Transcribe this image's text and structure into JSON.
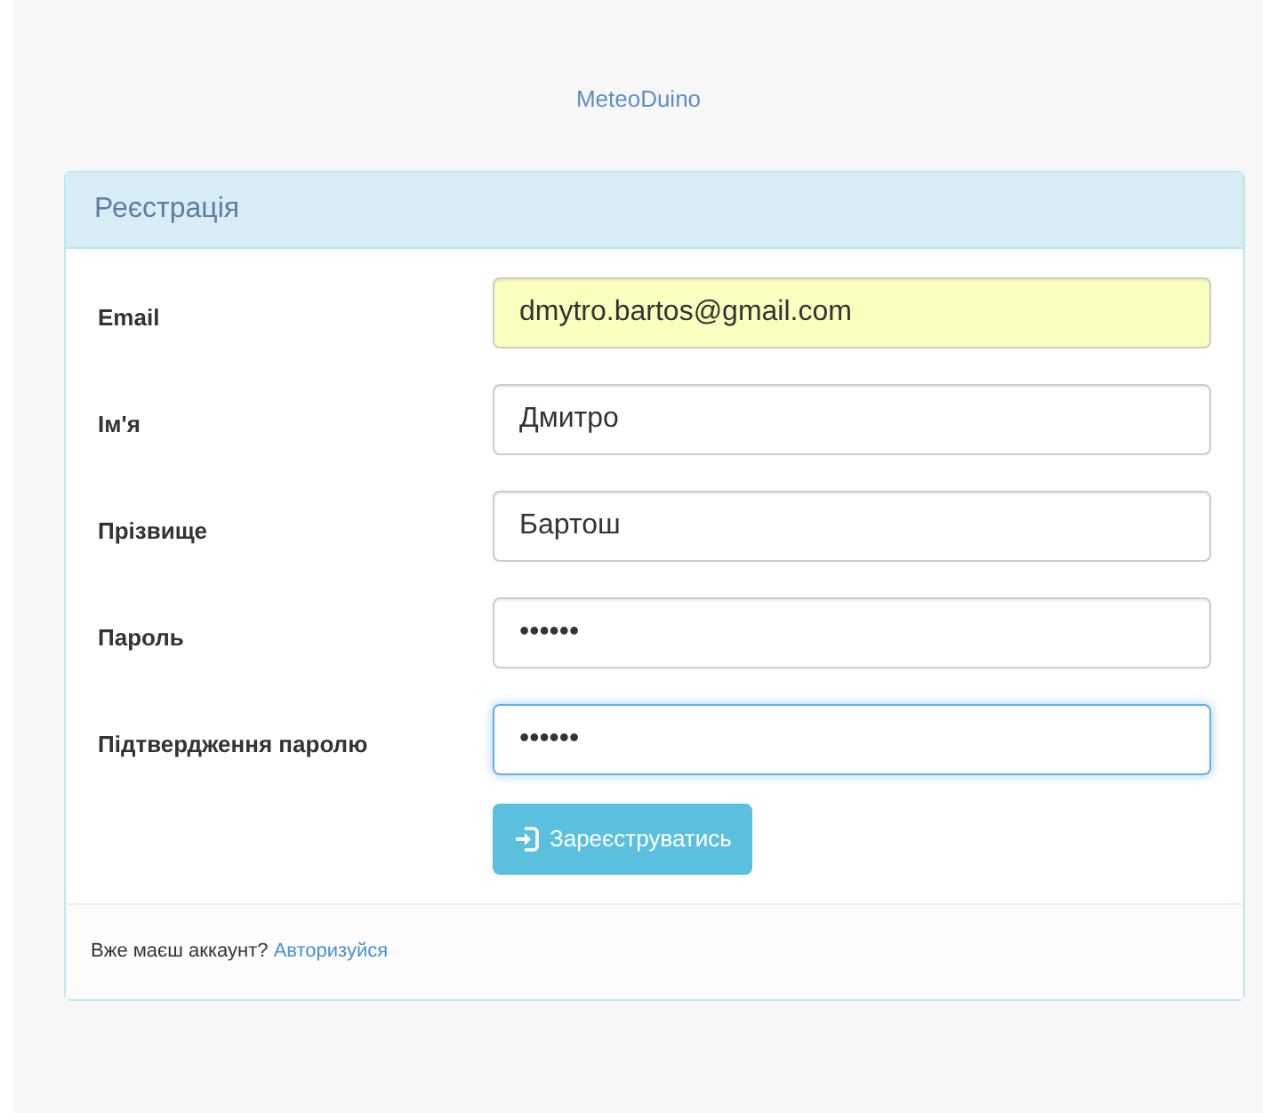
{
  "brand": "MeteoDuino",
  "panel": {
    "title": "Реєстрація",
    "fields": [
      {
        "label": "Email",
        "value": "dmytro.bartos@gmail.com",
        "autofilled": true,
        "focused": false
      },
      {
        "label": "Ім'я",
        "value": "Дмитро",
        "autofilled": false,
        "focused": false
      },
      {
        "label": "Прізвище",
        "value": "Бартош",
        "autofilled": false,
        "focused": false
      },
      {
        "label": "Пароль",
        "value": "••••••",
        "autofilled": false,
        "focused": false
      },
      {
        "label": "Підтвердження паролю",
        "value": "••••••",
        "autofilled": false,
        "focused": true
      }
    ],
    "button": "Зареєструватись",
    "footer": {
      "text": "Вже маєш аккаунт?",
      "link": "Авторизуйся"
    }
  }
}
